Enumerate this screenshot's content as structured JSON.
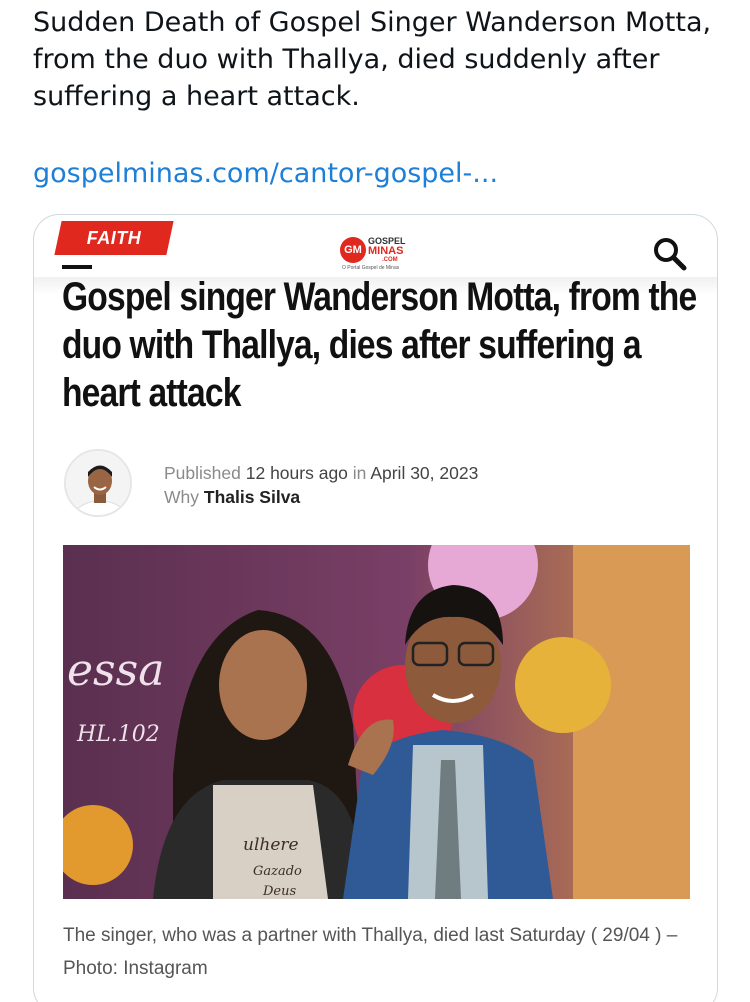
{
  "tweet": {
    "text": "Sudden Death of Gospel Singer Wanderson Motta, from the duo with Thallya, died suddenly after suffering a heart attack.",
    "link": "gospelminas.com/cantor-gospel-..."
  },
  "article": {
    "category": "FAITH",
    "logo": {
      "badge": "GM",
      "line1": "GOSPEL",
      "line2": "MINAS",
      "line3": ".COM",
      "tagline": "O Portal Gospel de Minas"
    },
    "headline": "Gospel singer Wanderson Motta, from the duo with Thallya, dies after suffering a heart attack",
    "meta": {
      "published_label": "Published",
      "published_time": "12 hours ago",
      "in_label": "in",
      "date": "April 30, 2023",
      "by_label": "Why",
      "author": "Thalis Silva"
    },
    "photo": {
      "backdrop_text": "essa",
      "backdrop_subtext": "HL.102",
      "shirt_text_1": "ulhere",
      "shirt_text_2": "Gazado",
      "shirt_text_3": "Deus"
    },
    "caption": "The singer, who was a partner with Thallya, died last Saturday ( 29/04 ) – Photo: Instagram"
  },
  "colors": {
    "accent_red": "#e0281f",
    "link_blue": "#1d7fd8"
  }
}
